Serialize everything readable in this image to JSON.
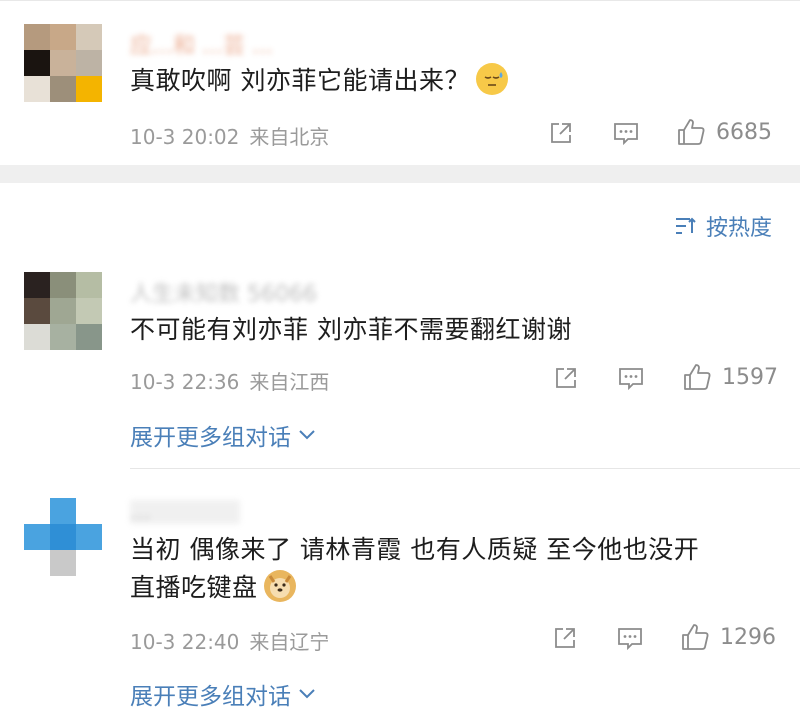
{
  "comments": [
    {
      "username": "应...和 ...芸 ...",
      "text": "真敢吹啊 刘亦菲它能请出来？",
      "emoji": "sweat-smile-emoji",
      "time": "10-3 20:02",
      "location": "来自北京",
      "likes": "6685"
    },
    {
      "username": "人生未知数 56066",
      "text": "不可能有刘亦菲 刘亦菲不需要翻红谢谢",
      "time": "10-3 22:36",
      "location": "来自江西",
      "likes": "1597",
      "expand": "展开更多组对话"
    },
    {
      "username": "...",
      "text_line1": "当初 偶像来了 请林青霞 也有人质疑 至今他也没开",
      "text_line2": "直播吃键盘",
      "emoji": "doge-emoji",
      "time": "10-3 22:40",
      "location": "来自辽宁",
      "likes": "1296",
      "expand": "展开更多组对话"
    }
  ],
  "sort_label": "按热度",
  "colors": {
    "link": "#4a7fb8",
    "meta": "#9a9a9a",
    "divider": "#efefef"
  }
}
